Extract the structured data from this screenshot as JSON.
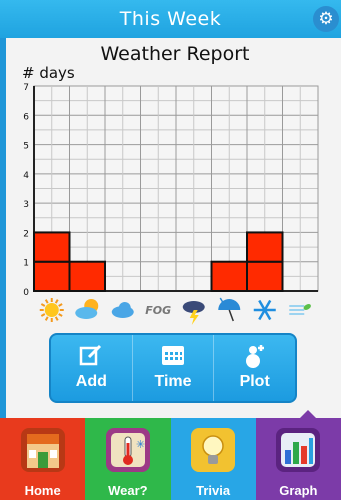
{
  "header": {
    "title": "This Week",
    "settings_icon": "gear-icon"
  },
  "chart_data": {
    "type": "bar",
    "title": "Weather Report",
    "ylabel": "# days",
    "xlabel": "",
    "ylim": [
      0,
      7
    ],
    "yticks": [
      "0",
      "1",
      "2",
      "3",
      "4",
      "5",
      "6",
      "7"
    ],
    "categories": [
      "Sunny",
      "Partly Cloudy",
      "Cloudy",
      "Fog",
      "Thunderstorm",
      "Rain",
      "Snow",
      "Windy"
    ],
    "category_icons": [
      "sun-icon",
      "partly-cloudy-icon",
      "cloud-icon",
      "fog-icon",
      "thunderstorm-icon",
      "umbrella-rain-icon",
      "snowflake-icon",
      "wind-icon"
    ],
    "category_text_labels": [
      "",
      "",
      "",
      "FOG",
      "",
      "",
      "",
      ""
    ],
    "values": [
      2,
      1,
      0,
      0,
      0,
      1,
      2,
      0
    ],
    "bar_color": "#ff2a00",
    "grid": true
  },
  "actions": [
    {
      "label": "Add",
      "icon": "edit-icon"
    },
    {
      "label": "Time",
      "icon": "calendar-icon"
    },
    {
      "label": "Plot",
      "icon": "plot-person-icon"
    }
  ],
  "tabs": [
    {
      "label": "Home",
      "icon": "house-icon",
      "color": "#e83a1d"
    },
    {
      "label": "Wear?",
      "icon": "thermometer-icon",
      "color": "#2fb84a"
    },
    {
      "label": "Trivia",
      "icon": "lightbulb-icon",
      "color": "#28a6e6"
    },
    {
      "label": "Graph",
      "icon": "bar-graph-icon",
      "color": "#7c3ba8",
      "selected": true
    }
  ]
}
